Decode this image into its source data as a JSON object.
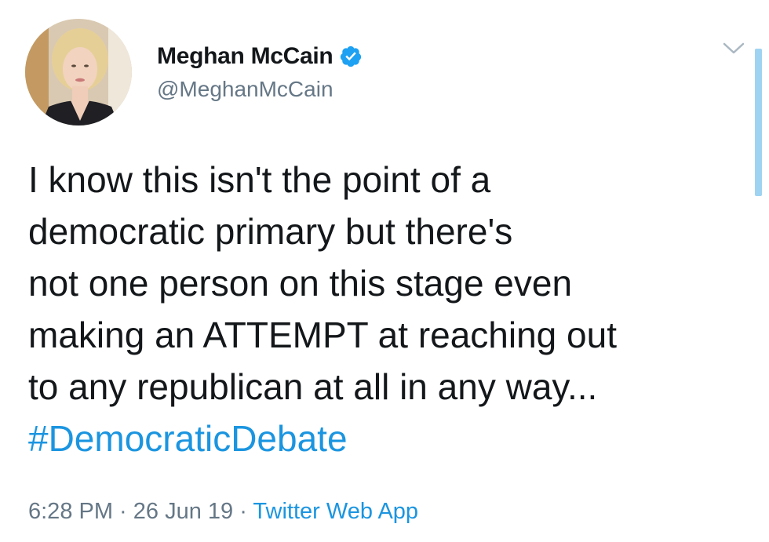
{
  "author": {
    "name": "Meghan McCain",
    "handle": "@MeghanMcCain",
    "verified": true,
    "avatar": "profile-photo"
  },
  "tweet": {
    "lines": [
      "I know this isn't the point of a",
      "democratic primary but there's",
      "not one person on this stage even",
      "making an ATTEMPT at reaching out",
      "to any republican at all in any way..."
    ],
    "hashtag": "#DemocraticDebate"
  },
  "meta": {
    "time": "6:28 PM",
    "separator": " · ",
    "date": "26 Jun 19",
    "source": "Twitter Web App"
  },
  "icons": {
    "verified": "verified-badge-icon",
    "menu": "chevron-down-icon"
  },
  "colors": {
    "link": "#1b95e0",
    "secondary_text": "#657786",
    "primary_text": "#14171a",
    "scrollbar": "#9fd3f2"
  }
}
